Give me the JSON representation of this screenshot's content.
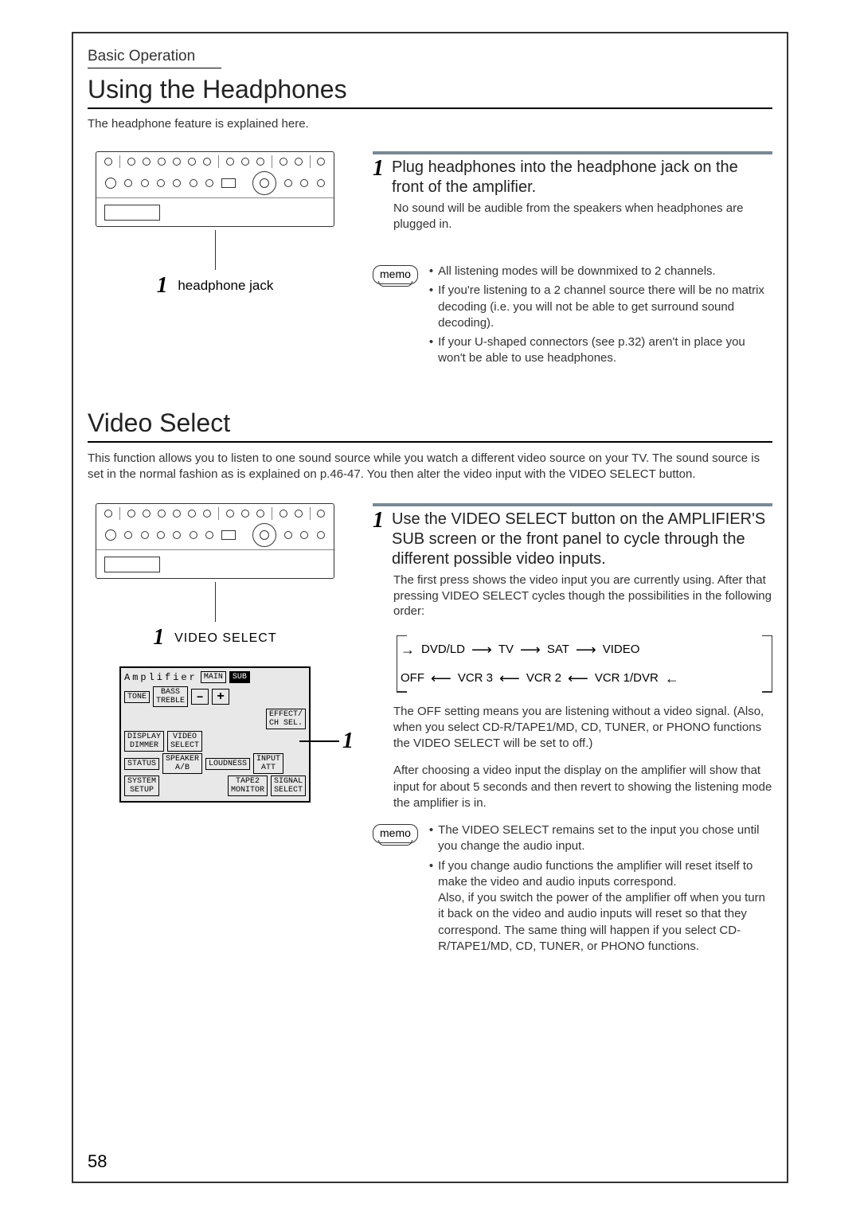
{
  "section_tab": "Basic Operation",
  "page_number": "58",
  "headphones": {
    "heading": "Using the Headphones",
    "intro": "The headphone feature is explained here.",
    "caption_num": "1",
    "caption": "headphone jack",
    "step_num": "1",
    "step_title": "Plug headphones into the headphone jack on the front of the amplifier.",
    "step_body": "No sound will be audible from the speakers when headphones are plugged in.",
    "memo_label": "memo",
    "memo_items": [
      "All listening modes will be downmixed to 2 channels.",
      "If you're listening to a 2 channel source there will be no matrix decoding (i.e. you will not be able to get surround sound decoding).",
      "If your U-shaped connectors (see p.32) aren't in place you won't be able to use headphones."
    ]
  },
  "video": {
    "heading": "Video Select",
    "intro": "This function allows you to listen to one sound source while you watch a different video source on your TV. The sound source is set in the normal fashion as is explained on p.46-47. You then alter the video input with the VIDEO SELECT button.",
    "caption_num": "1",
    "caption": "VIDEO SELECT",
    "remote": {
      "title": "Amplifier",
      "main": "MAIN",
      "sub": "SUB",
      "tone": "TONE",
      "bass": "BASS",
      "treble": "TREBLE",
      "minus": "–",
      "plus": "+",
      "display": "DISPLAY",
      "dimmer": "DIMMER",
      "videosel": "VIDEO\nSELECT",
      "effect": "EFFECT/\nCH SEL.",
      "status": "STATUS",
      "speaker": "SPEAKER\nA/B",
      "loudness": "LOUDNESS",
      "input_att": "INPUT\nATT",
      "system": "SYSTEM\nSETUP",
      "tape_mon": "TAPE2\nMONITOR",
      "signal": "SIGNAL\nSELECT",
      "leader_num": "1"
    },
    "step_num": "1",
    "step_title": "Use the VIDEO SELECT button on the AMPLIFIER'S SUB screen or the front panel to cycle through the different possible video inputs.",
    "step_body": "The first press shows the video input you are currently using. After that pressing VIDEO SELECT cycles though the possibilities in the following order:",
    "cycle": {
      "items_fwd": [
        "DVD/LD",
        "TV",
        "SAT",
        "VIDEO"
      ],
      "items_rev": [
        "OFF",
        "VCR 3",
        "VCR 2",
        "VCR 1/DVR"
      ]
    },
    "para_off": "The OFF setting means you are listening without a video signal. (Also, when you select CD-R/TAPE1/MD, CD, TUNER, or PHONO functions the VIDEO SELECT will be set to off.)",
    "para_after": "After choosing a video input the display on the amplifier will show that input for about 5 seconds and then revert to showing the listening mode the amplifier is in.",
    "memo_label": "memo",
    "memo_items": [
      "The VIDEO SELECT remains set to the input you chose until you change the audio input.",
      "If you change audio functions the amplifier will reset itself to make the video and audio inputs correspond.\nAlso, if you switch the power of the amplifier off when you turn it back on the video and audio inputs will reset so that they correspond. The same thing will happen if you select CD-R/TAPE1/MD, CD, TUNER, or PHONO functions."
    ]
  }
}
